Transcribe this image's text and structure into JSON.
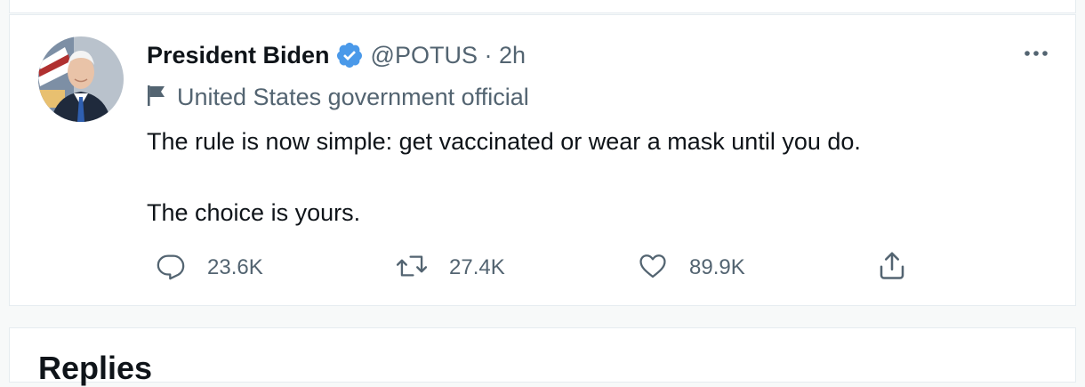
{
  "tweet": {
    "author_name": "President Biden",
    "handle_time": "@POTUS · 2h",
    "label": "United States government official",
    "text_line1": "The rule is now simple: get vaccinated or wear a mask until you do.",
    "text_line2": "The choice is yours.",
    "replies": "23.6K",
    "retweets": "27.4K",
    "likes": "89.9K"
  },
  "section": {
    "heading": "Replies"
  },
  "colors": {
    "verified": "#1d9bf0",
    "secondary_text": "#536471",
    "primary_text": "#0f1419"
  },
  "icons": [
    "verified-badge-icon",
    "more-icon",
    "flag-icon",
    "reply-icon",
    "retweet-icon",
    "like-icon",
    "share-icon"
  ]
}
